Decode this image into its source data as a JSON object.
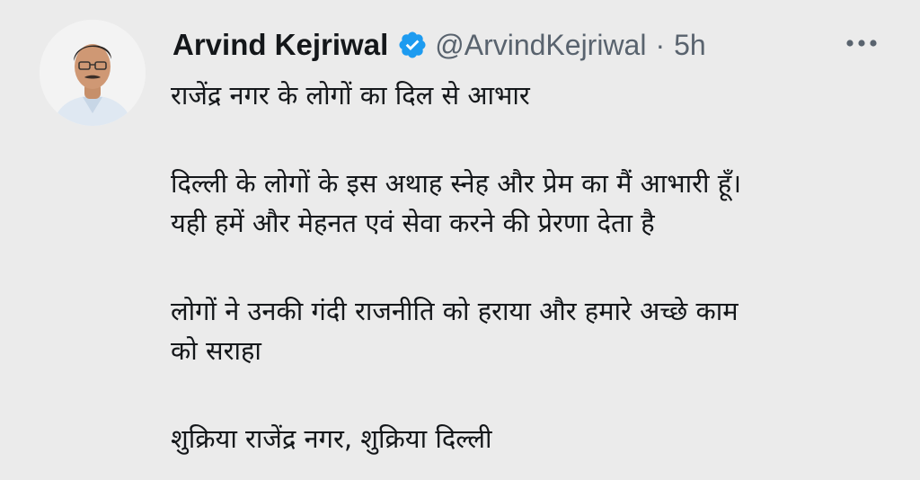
{
  "author": {
    "name": "Arvind Kejriwal",
    "handle": "@ArvindKejriwal",
    "separator": "·",
    "time": "5h",
    "verified_color": "#1d9bf0"
  },
  "icons": {
    "verified": "verified-badge-icon",
    "more": "more-options-icon"
  },
  "tweet": {
    "paragraphs": [
      [
        "राजेंद्र नगर के लोगों का दिल से आभार"
      ],
      [
        "दिल्ली के लोगों के इस अथाह स्नेह और प्रेम का मैं आभारी हूँ।",
        "यही हमें और मेहनत एवं सेवा करने की प्रेरणा देता है"
      ],
      [
        "लोगों ने उनकी गंदी राजनीति को हराया और हमारे अच्छे काम",
        "को सराहा"
      ],
      [
        "शुक्रिया राजेंद्र नगर, शुक्रिया दिल्ली"
      ]
    ]
  }
}
